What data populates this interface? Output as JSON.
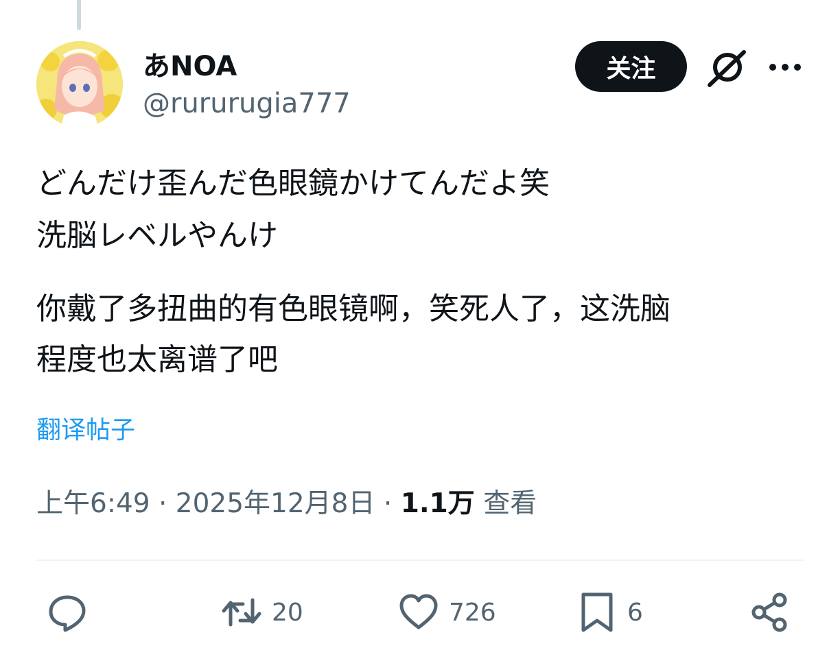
{
  "post": {
    "author": {
      "display_name": "あNOA",
      "handle": "@rururugia777"
    },
    "follow_label": "关注",
    "text_lines_original": [
      "どんだけ歪んだ色眼鏡かけてんだよ笑",
      "洗脳レベルやんけ"
    ],
    "text_lines_translation": [
      "你戴了多扭曲的有色眼镜啊，笑死人了，这洗脑",
      "程度也太离谱了吧"
    ],
    "translate_label": "翻译帖子",
    "meta": {
      "time": "上午6:49",
      "sep1": " · ",
      "date": "2025年12月8日",
      "sep2": " · ",
      "views_count": "1.1万",
      "views_label": " 查看"
    },
    "actions": {
      "reply": {
        "icon": "reply-icon"
      },
      "retweet": {
        "icon": "retweet-icon",
        "count": "20"
      },
      "like": {
        "icon": "heart-icon",
        "count": "726"
      },
      "bookmark": {
        "icon": "bookmark-icon",
        "count": "6"
      },
      "share": {
        "icon": "share-icon"
      }
    }
  },
  "colors": {
    "text": "#0f1419",
    "secondary": "#536471",
    "link": "#1d9bf0",
    "button_bg": "#0f1419",
    "divider": "#eff3f4"
  }
}
